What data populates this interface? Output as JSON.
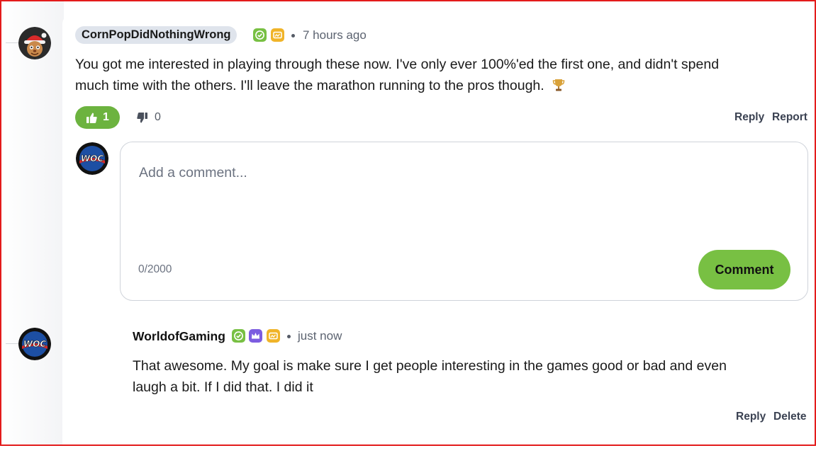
{
  "colors": {
    "accent_green": "#6cb33f",
    "comment_button": "#78c043",
    "frame_red": "#e31b1b",
    "author_chip_bg": "#dfe4ec"
  },
  "comment": {
    "author": "CornPopDidNothingWrong",
    "avatar_icon": "snowman-santa-avatar",
    "badges": [
      "verified-check-badge",
      "member-card-badge"
    ],
    "time": "7 hours ago",
    "body_line1": "You got me interested in playing through these now. I've only ever 100%'ed the first one, and didn't spend",
    "body_line2": "much time with the others. I'll leave the marathon running to the pros though.",
    "trophy_emoji": "🏆",
    "likes": "1",
    "dislikes": "0",
    "reply_label": "Reply",
    "report_label": "Report"
  },
  "composer": {
    "avatar_icon": "woc-logo-avatar",
    "placeholder": "Add a comment...",
    "char_count": "0/2000",
    "submit_label": "Comment"
  },
  "reply": {
    "author": "WorldofGaming",
    "avatar_icon": "woc-logo-avatar",
    "badges": [
      "verified-check-badge",
      "crown-badge",
      "member-card-badge"
    ],
    "time": "just now",
    "body_line1": "That awesome. My goal is make sure I get people interesting in the games good or bad and even",
    "body_line2": "laugh a bit. If I did that. I did it",
    "reply_label": "Reply",
    "delete_label": "Delete"
  }
}
